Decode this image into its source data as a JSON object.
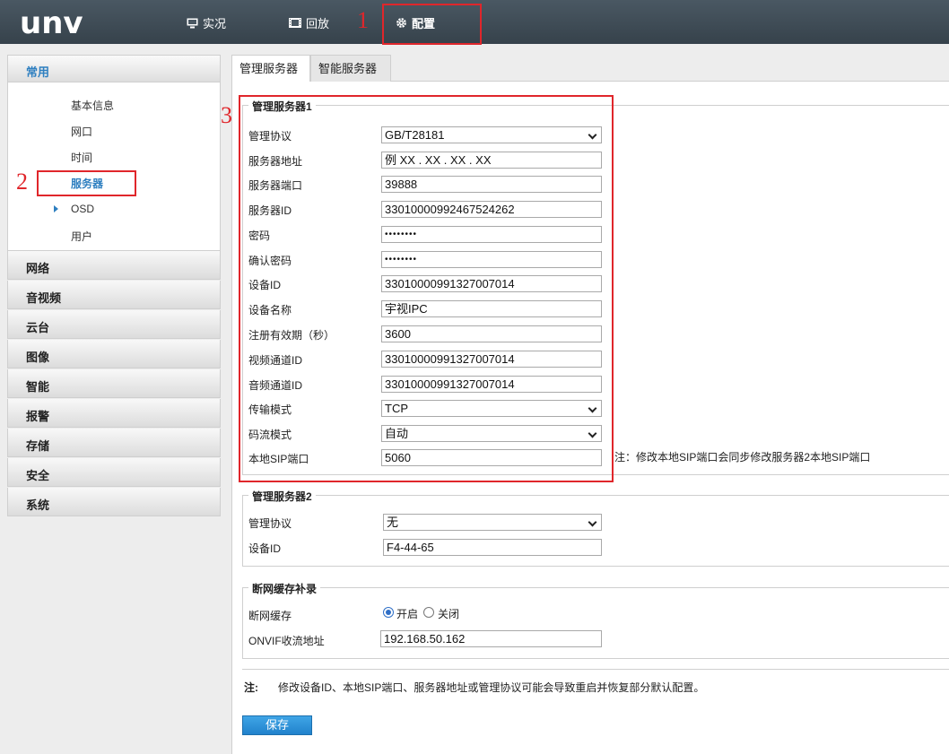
{
  "app": {
    "logo": "unv"
  },
  "nav": {
    "live": "实况",
    "playback": "回放",
    "config": "配置"
  },
  "annotations": [
    "1",
    "2",
    "3"
  ],
  "sidebar": {
    "common_header": "常用",
    "sub_items": [
      "基本信息",
      "网口",
      "时间",
      "服务器",
      "OSD",
      "用户"
    ],
    "active_sub": "服务器",
    "categories": [
      "网络",
      "音视频",
      "云台",
      "图像",
      "智能",
      "报警",
      "存储",
      "安全",
      "系统"
    ]
  },
  "tabs": {
    "mgr": "管理服务器",
    "smart": "智能服务器"
  },
  "server1": {
    "legend": "管理服务器1",
    "rows": [
      {
        "label": "管理协议",
        "value": "GB/T28181"
      },
      {
        "label": "服务器地址",
        "value": "例 XX . XX . XX . XX"
      },
      {
        "label": "服务器端口",
        "value": "39888"
      },
      {
        "label": "服务器ID",
        "value": "33010000992467524262"
      },
      {
        "label": "密码",
        "value": "••••••••"
      },
      {
        "label": "确认密码",
        "value": "••••••••"
      },
      {
        "label": "设备ID",
        "value": "33010000991327007014"
      },
      {
        "label": "设备名称",
        "value": "宇视IPC"
      },
      {
        "label": "注册有效期（秒）",
        "value": "3600"
      },
      {
        "label": "视频通道ID",
        "value": "33010000991327007014"
      },
      {
        "label": "音频通道ID",
        "value": "33010000991327007014"
      },
      {
        "label": "传输模式",
        "value": "TCP"
      },
      {
        "label": "码流模式",
        "value": "自动"
      },
      {
        "label": "本地SIP端口",
        "value": "5060"
      }
    ],
    "sip_note": "注：修改本地SIP端口会同步修改服务器2本地SIP端口"
  },
  "server2": {
    "legend": "管理服务器2",
    "rows": [
      {
        "label": "管理协议",
        "value": "无"
      },
      {
        "label": "设备ID",
        "value": "F4-44-65"
      }
    ]
  },
  "cache": {
    "legend": "断网缓存补录",
    "cache_label": "断网缓存",
    "on_label": "开启",
    "off_label": "关闭",
    "onvif_label": "ONVIF收流地址",
    "onvif_value": "192.168.50.162"
  },
  "footer": {
    "note_prefix": "注:",
    "note_text": "修改设备ID、本地SIP端口、服务器地址或管理协议可能会导致重启并恢复部分默认配置。",
    "save_label": "保存"
  },
  "colors": {
    "accent": "#2e7fc0",
    "annotation": "#e0262b",
    "topbar": "#3e4a54",
    "button": "#2b8fd8"
  }
}
